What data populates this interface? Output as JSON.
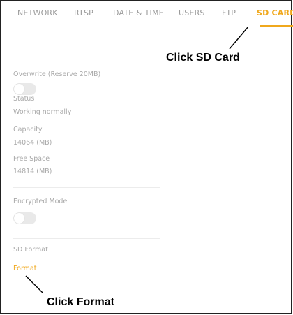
{
  "tabs": [
    {
      "label": "NETWORK",
      "active": false
    },
    {
      "label": "RTSP",
      "active": false
    },
    {
      "label": "DATE & TIME",
      "active": false
    },
    {
      "label": "USERS",
      "active": false
    },
    {
      "label": "FTP",
      "active": false
    },
    {
      "label": "SD CARD",
      "active": true
    }
  ],
  "settings": {
    "overwrite_label": "Overwrite (Reserve 20MB)",
    "overwrite_enabled": false,
    "status_label": "Status",
    "status_value": "Working normally",
    "capacity_label": "Capacity",
    "capacity_value": "14064 (MB)",
    "free_space_label": "Free Space",
    "free_space_value": "14814 (MB)",
    "encrypted_label": "Encrypted Mode",
    "encrypted_enabled": false,
    "sd_format_label": "SD Format",
    "format_link": "Format"
  },
  "annotations": {
    "click_sd_card": "Click SD Card",
    "click_format": "Click Format"
  },
  "colors": {
    "accent": "#f0a81c",
    "muted_text": "#a9a9a9"
  }
}
